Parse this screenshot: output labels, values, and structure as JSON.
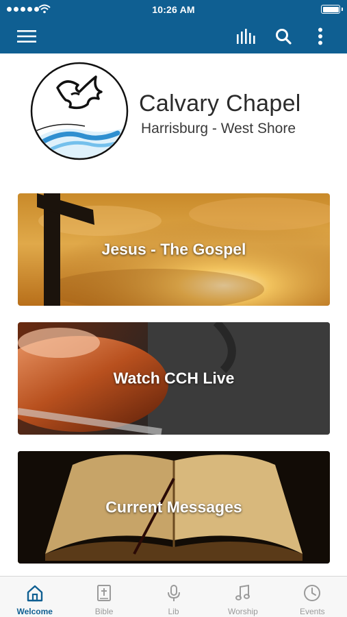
{
  "status_bar": {
    "time": "10:26 AM"
  },
  "nav": {
    "icons": [
      "menu-icon",
      "audio-bars-icon",
      "search-icon",
      "more-vertical-icon"
    ]
  },
  "logo": {
    "name": "Calvary Chapel",
    "subtitle": "Harrisburg - West Shore"
  },
  "cards": [
    {
      "label": "Jesus - The Gospel"
    },
    {
      "label": "Watch CCH Live"
    },
    {
      "label": "Current Messages"
    }
  ],
  "tabs": [
    {
      "label": "Welcome",
      "icon": "home-icon",
      "active": true
    },
    {
      "label": "Bible",
      "icon": "bible-icon",
      "active": false
    },
    {
      "label": "Lib",
      "icon": "microphone-icon",
      "active": false
    },
    {
      "label": "Worship",
      "icon": "music-note-icon",
      "active": false
    },
    {
      "label": "Events",
      "icon": "clock-icon",
      "active": false
    }
  ],
  "colors": {
    "brand": "#0f5f92",
    "tab_inactive": "#9a9a9a",
    "tabbar_bg": "#f7f7f7"
  }
}
